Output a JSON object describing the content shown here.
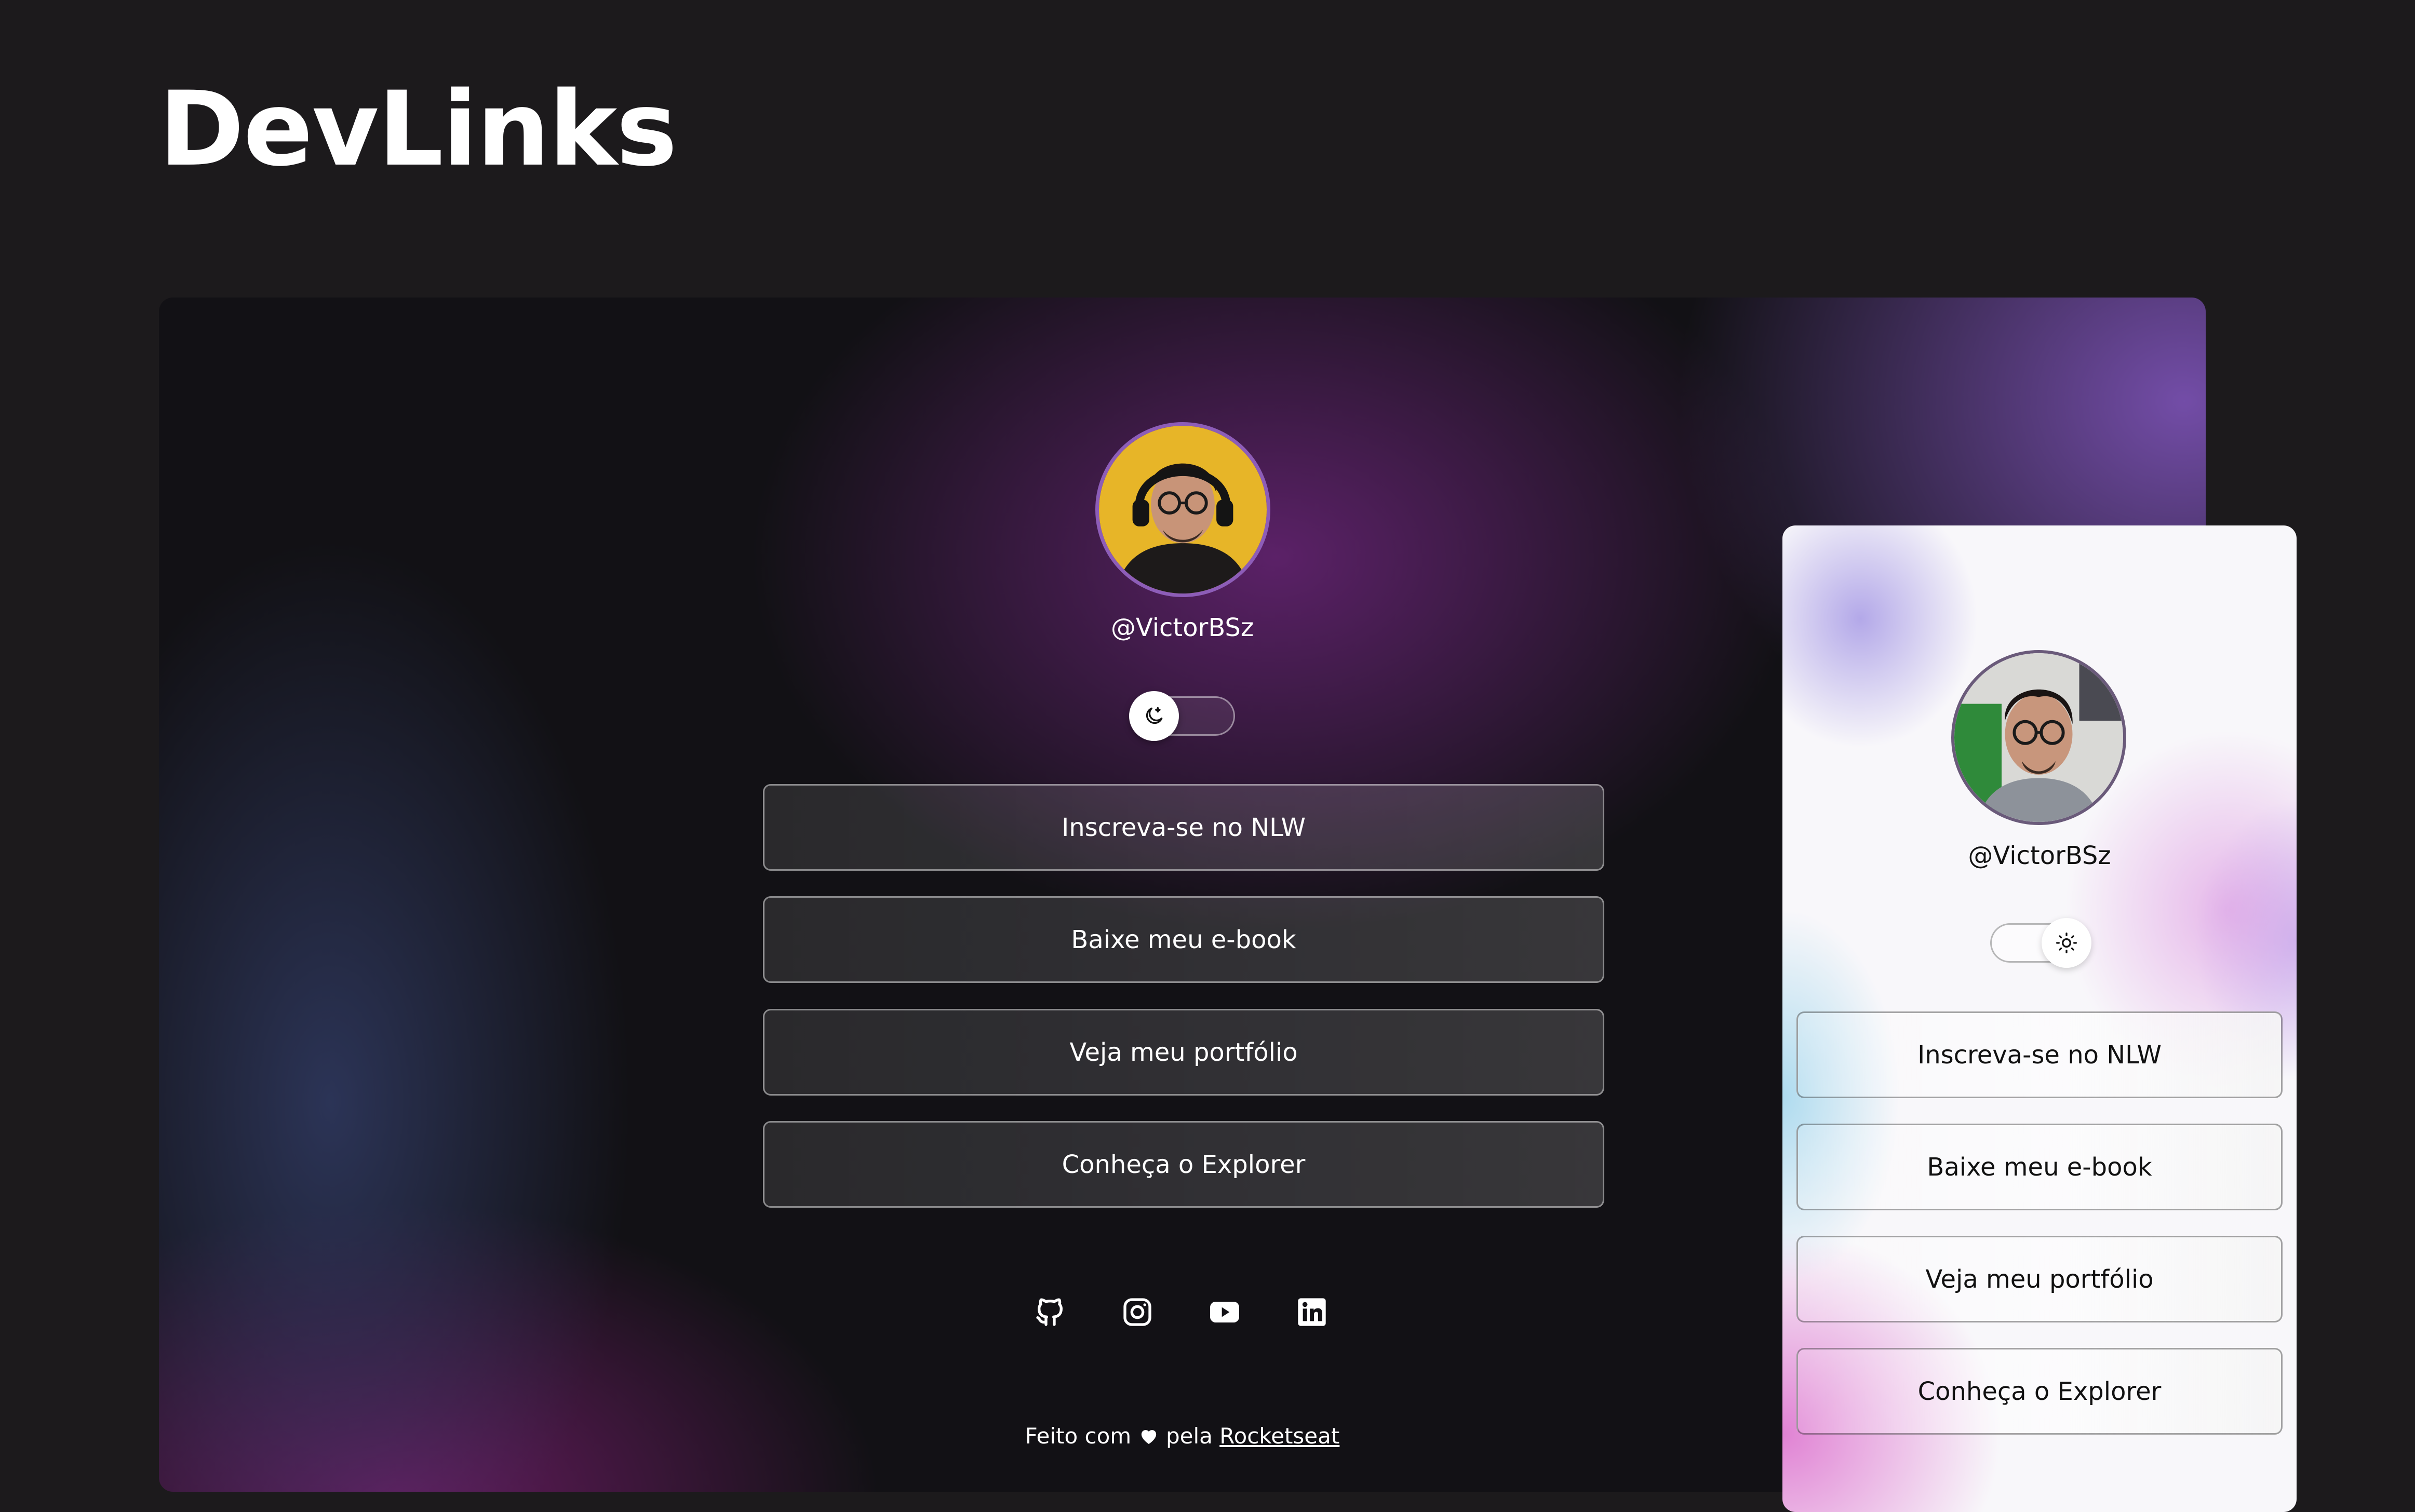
{
  "header": {
    "title": "DevLinks"
  },
  "dark_preview": {
    "username": "@VictorBSz",
    "theme_toggle": {
      "mode": "dark",
      "knob_icon": "moon-icon"
    },
    "links": [
      {
        "label": "Inscreva-se no NLW"
      },
      {
        "label": "Baixe meu e-book"
      },
      {
        "label": "Veja meu portfólio"
      },
      {
        "label": "Conheça o Explorer"
      }
    ],
    "social": [
      "github-icon",
      "instagram-icon",
      "youtube-icon",
      "linkedin-icon"
    ],
    "footer": {
      "prefix": "Feito com",
      "middle": "pela",
      "link": "Rocketseat"
    }
  },
  "light_preview": {
    "username": "@VictorBSz",
    "theme_toggle": {
      "mode": "light",
      "knob_icon": "sun-icon"
    },
    "links": [
      {
        "label": "Inscreva-se no NLW"
      },
      {
        "label": "Baixe meu e-book"
      },
      {
        "label": "Veja meu portfólio"
      },
      {
        "label": "Conheça o Explorer"
      }
    ]
  },
  "colors": {
    "page_background": "#1c1a1c",
    "accent_purple": "#8d5db8",
    "avatar_dark_background": "#e7b528",
    "avatar_light_background": "#2f8a3a"
  }
}
